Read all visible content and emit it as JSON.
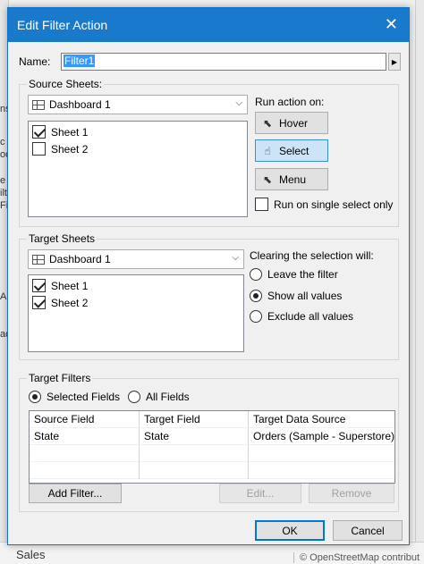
{
  "dialog": {
    "title": "Edit Filter Action",
    "name_label": "Name:",
    "name_value": "Filter1"
  },
  "source_sheets": {
    "legend": "Source Sheets:",
    "dashboard": "Dashboard 1",
    "items": [
      {
        "label": "Sheet 1",
        "checked": true
      },
      {
        "label": "Sheet 2",
        "checked": false
      }
    ]
  },
  "run_action": {
    "label": "Run action on:",
    "hover": "Hover",
    "select": "Select",
    "menu": "Menu",
    "selected": "Select",
    "single_select_label": "Run on single select only",
    "single_select_checked": false
  },
  "target_sheets": {
    "legend": "Target Sheets",
    "dashboard": "Dashboard 1",
    "items": [
      {
        "label": "Sheet 1",
        "checked": true
      },
      {
        "label": "Sheet 2",
        "checked": true
      }
    ]
  },
  "clearing": {
    "label": "Clearing the selection will:",
    "options": [
      "Leave the filter",
      "Show all values",
      "Exclude all values"
    ],
    "selected": "Show all values"
  },
  "target_filters": {
    "legend": "Target Filters",
    "selected_fields": "Selected Fields",
    "all_fields": "All Fields",
    "selected": "Selected Fields",
    "columns": [
      "Source Field",
      "Target Field",
      "Target Data Source"
    ],
    "rows": [
      [
        "State",
        "State",
        "Orders (Sample - Superstore)"
      ]
    ],
    "add_filter": "Add Filter...",
    "edit": "Edit...",
    "remove": "Remove"
  },
  "footer": {
    "ok": "OK",
    "cancel": "Cancel"
  },
  "background": {
    "fragments": [
      "ns",
      "c",
      "oo",
      "e",
      "ilt",
      "Fil",
      "A",
      "ao"
    ],
    "bottom_left": "Sales",
    "bottom_right": "© OpenStreetMap contribut"
  }
}
